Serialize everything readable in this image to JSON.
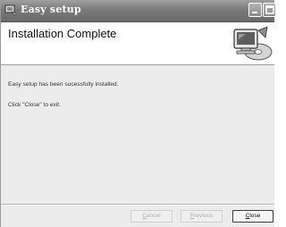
{
  "window": {
    "title": "Easy setup",
    "icon": "setup-app-icon",
    "title_buttons": [
      "minimize-icon",
      "maximize-icon"
    ]
  },
  "header": {
    "title": "Installation Complete",
    "illustration": "computer-installation-icon"
  },
  "content": {
    "message_installed": "Easy setup has been sucessfully installed.",
    "message_exit": "Click \"Close\" to exit."
  },
  "buttons": {
    "cancel": {
      "label": "Cancel",
      "mnemonic": "C",
      "rest": "ancel",
      "enabled": false
    },
    "previous": {
      "label": "Previous",
      "mnemonic": "P",
      "rest": "revious",
      "enabled": false
    },
    "close": {
      "label": "Close",
      "mnemonic": "C",
      "rest": "lose",
      "enabled": true
    }
  },
  "colors": {
    "titlebar": "#7a7a7a",
    "body_background": "#ececec",
    "header_background": "#ffffff"
  }
}
